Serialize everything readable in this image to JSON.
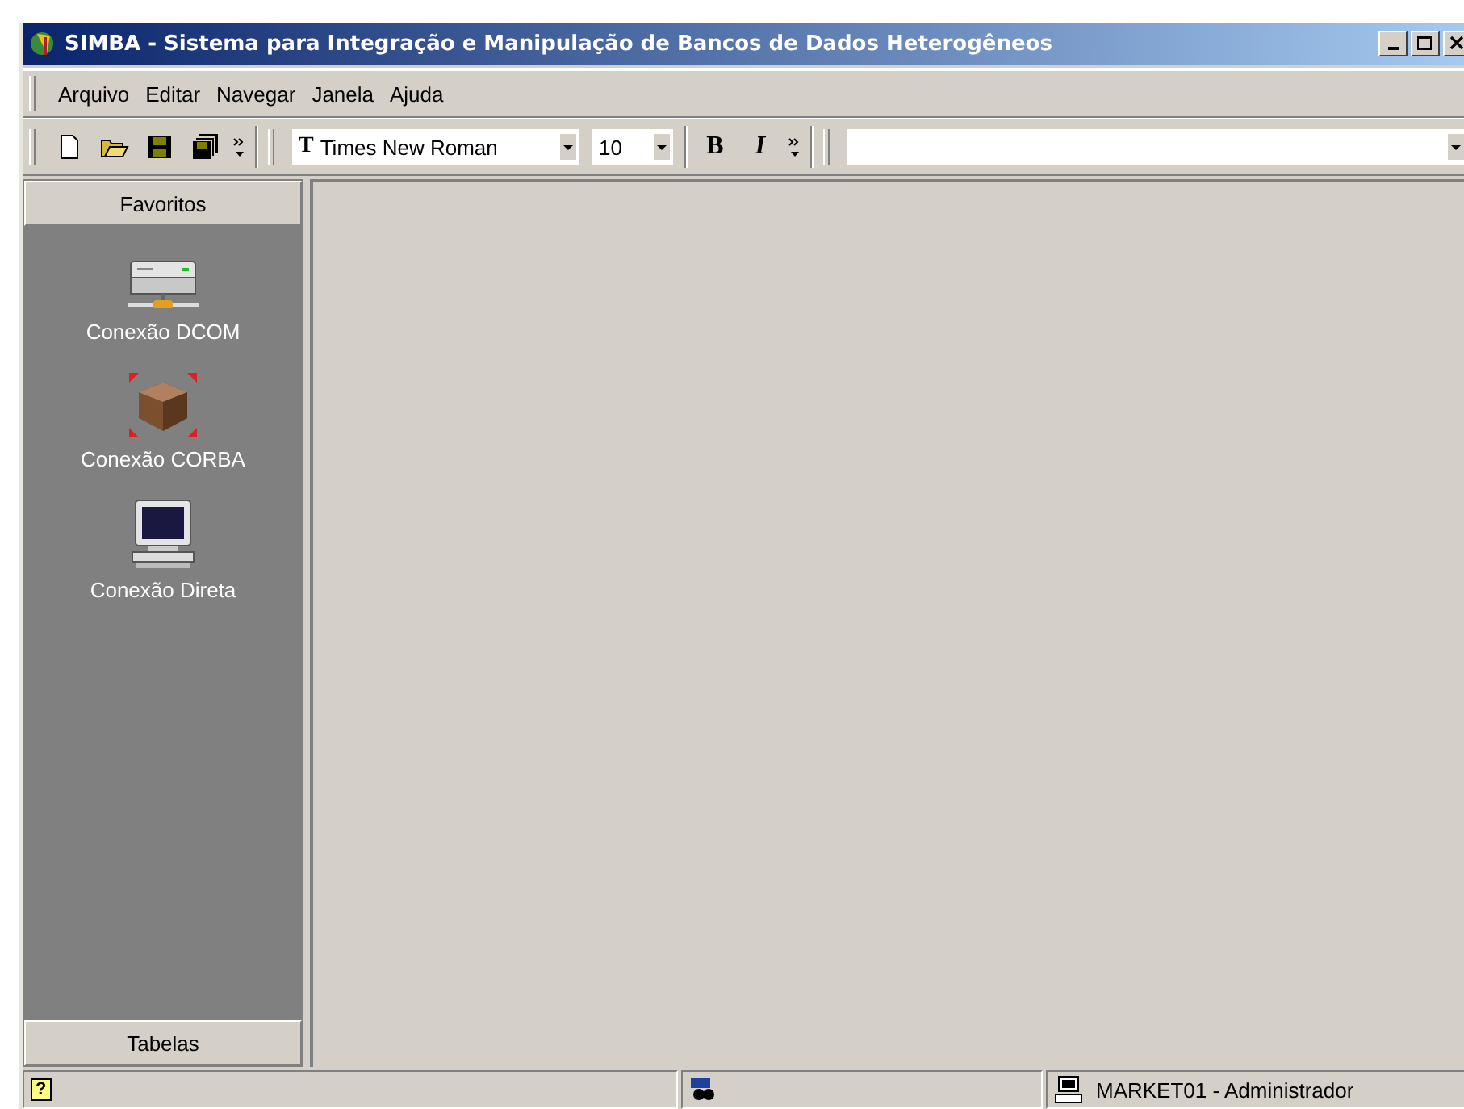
{
  "window": {
    "title": "SIMBA - Sistema para Integração e Manipulação de Bancos de Dados Heterogêneos"
  },
  "menu": [
    "Arquivo",
    "Editar",
    "Navegar",
    "Janela",
    "Ajuda"
  ],
  "toolbar": {
    "font_icon": "T",
    "font": "Times New Roman",
    "size": "10",
    "bold": "B",
    "italic": "I"
  },
  "sidebar": {
    "header": "Favoritos",
    "items": [
      {
        "label": "Conexão DCOM"
      },
      {
        "label": "Conexão CORBA"
      },
      {
        "label": "Conexão Direta"
      }
    ],
    "footer": "Tabelas"
  },
  "status_bar": {
    "help": "?",
    "user": "MARKET01 - Administrador"
  }
}
